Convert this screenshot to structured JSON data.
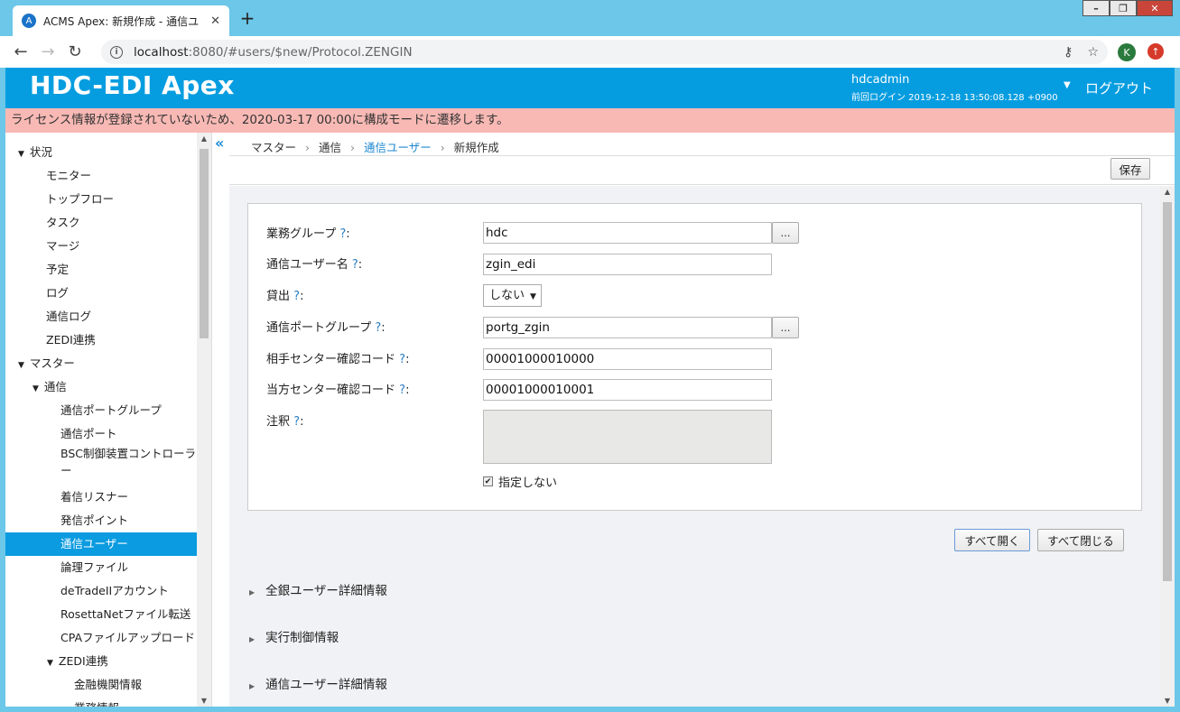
{
  "browser": {
    "tab_title": "ACMS Apex: 新規作成 - 通信ユ",
    "tab_favicon": "A",
    "tab_close": "✕",
    "new_tab": "+",
    "url_host": "localhost",
    "url_rest": ":8080/#users/$new/Protocol.ZENGIN",
    "avatar_letter": "K",
    "window_buttons": [
      "–",
      "❐",
      "✕"
    ]
  },
  "header": {
    "logo": "HDC-EDI Apex",
    "username": "hdcadmin",
    "last_login": "前回ログイン 2019-12-18 13:50:08.128 +0900",
    "logout": "ログアウト"
  },
  "alert": "ライセンス情報が登録されていないため、2020-03-17 00:00に構成モードに遷移します。",
  "sidebar": {
    "items": [
      {
        "label": "状況",
        "caret": "▼"
      },
      {
        "label": "モニター"
      },
      {
        "label": "トップフロー"
      },
      {
        "label": "タスク"
      },
      {
        "label": "マージ"
      },
      {
        "label": "予定"
      },
      {
        "label": "ログ"
      },
      {
        "label": "通信ログ"
      },
      {
        "label": "ZEDI連携"
      },
      {
        "label": "マスター",
        "caret": "▼"
      },
      {
        "label": "通信",
        "caret": "▼"
      },
      {
        "label": "通信ポートグループ"
      },
      {
        "label": "通信ポート"
      },
      {
        "label": "BSC制御装置コントローラ"
      },
      {
        "label": "ー"
      },
      {
        "label": "着信リスナー"
      },
      {
        "label": "発信ポイント"
      },
      {
        "label": "通信ユーザー"
      },
      {
        "label": "論理ファイル"
      },
      {
        "label": "deTradeIIアカウント"
      },
      {
        "label": "RosettaNetファイル転送"
      },
      {
        "label": "CPAファイルアップロード"
      },
      {
        "label": "ZEDI連携",
        "caret": "▼"
      },
      {
        "label": "金融機関情報"
      },
      {
        "label": "業務情報"
      }
    ]
  },
  "breadcrumb": [
    "マスター",
    "通信",
    "通信ユーザー",
    "新規作成"
  ],
  "toolbar": {
    "save": "保存"
  },
  "form": {
    "fields": [
      {
        "label": "業務グループ",
        "value": "hdc"
      },
      {
        "label": "通信ユーザー名",
        "value": "zgin_edi"
      },
      {
        "label": "貸出",
        "value": "しない"
      },
      {
        "label": "通信ポートグループ",
        "value": "portg_zgin"
      },
      {
        "label": "相手センター確認コード",
        "value": "00001000010000"
      },
      {
        "label": "当方センター確認コード",
        "value": "00001000010001"
      },
      {
        "label": "注釈",
        "value": ""
      }
    ],
    "help_mark": "?",
    "colon": ":",
    "dots": "…",
    "checkbox_label": "指定しない",
    "checkbox_checked": "✔"
  },
  "actions": {
    "open_all": "すべて開く",
    "close_all": "すべて閉じる"
  },
  "sections": [
    "全銀ユーザー詳細情報",
    "実行制御情報",
    "通信ユーザー詳細情報"
  ],
  "collapse_icon": "«"
}
